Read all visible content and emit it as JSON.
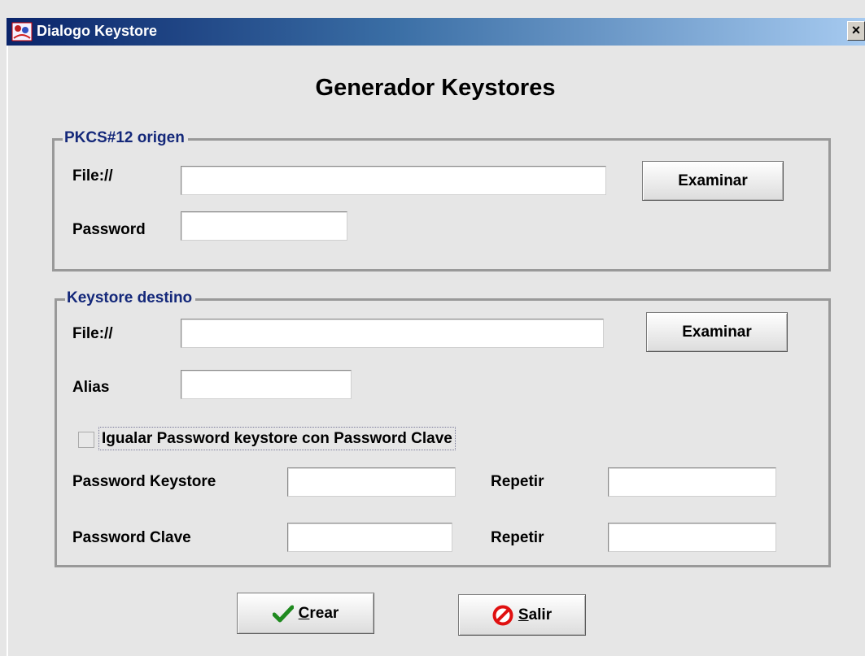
{
  "window": {
    "title": "Dialogo Keystore",
    "close_glyph": "×",
    "app_icon": "app-icon"
  },
  "heading": "Generador Keystores",
  "origin_group": {
    "title": "PKCS#12 origen",
    "file_label": "File://",
    "file_value": "",
    "browse_label": "Examinar",
    "password_label": "Password",
    "password_value": ""
  },
  "dest_group": {
    "title": "Keystore destino",
    "file_label": "File://",
    "file_value": "",
    "browse_label": "Examinar",
    "alias_label": "Alias",
    "alias_value": "",
    "match_checkbox_label": "Igualar Password keystore con Password Clave",
    "match_checked": false,
    "pw_keystore_label": "Password Keystore",
    "pw_keystore_value": "",
    "repeat1_label": "Repetir",
    "repeat1_value": "",
    "pw_key_label": "Password Clave",
    "pw_key_value": "",
    "repeat2_label": "Repetir",
    "repeat2_value": ""
  },
  "actions": {
    "create_mnemonic": "C",
    "create_rest": "rear",
    "create_icon": "checkmark-icon",
    "exit_mnemonic": "S",
    "exit_rest": "alir",
    "exit_icon": "no-entry-icon"
  },
  "colors": {
    "title_gradient_start": "#0a246a",
    "title_gradient_end": "#a6caf0",
    "group_title": "#14287a",
    "check_green": "#1f8a1f",
    "stop_red": "#e01010"
  }
}
